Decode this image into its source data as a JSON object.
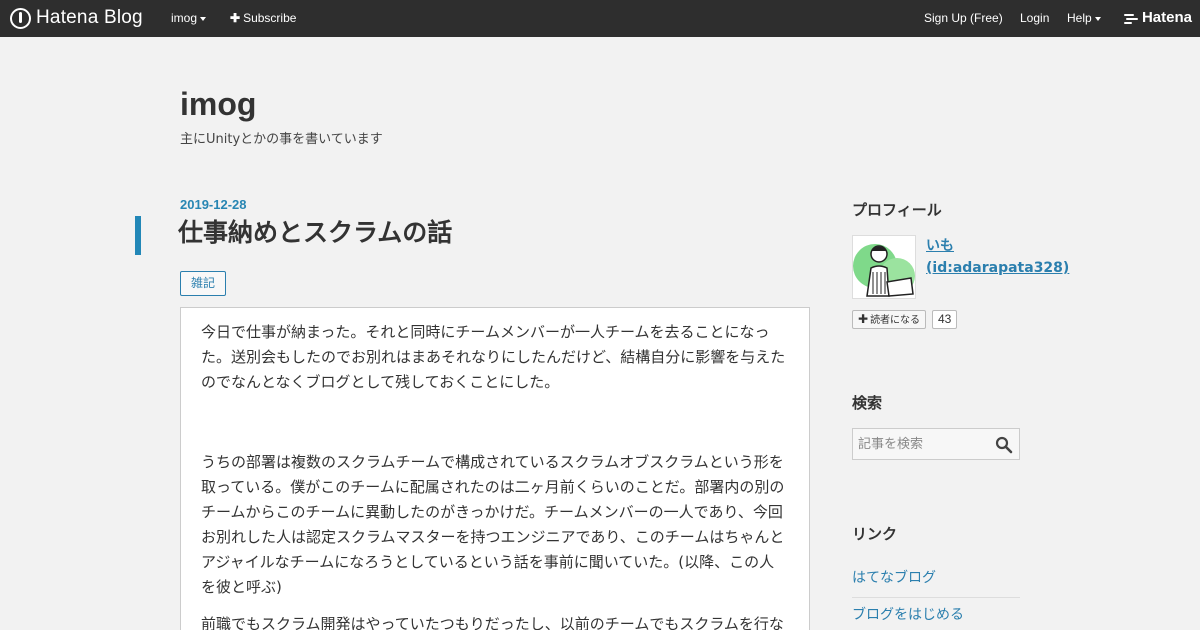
{
  "topbar": {
    "brand": "Hatena Blog",
    "blog_menu": "imog",
    "subscribe": "Subscribe",
    "signup": "Sign Up (Free)",
    "login": "Login",
    "help": "Help",
    "hatena": "Hatena"
  },
  "blog": {
    "title": "imog",
    "description": "主にUnityとかの事を書いています"
  },
  "entry": {
    "date": "2019-12-28",
    "title": "仕事納めとスクラムの話",
    "category": "雑記",
    "paragraphs": [
      "今日で仕事が納まった。それと同時にチームメンバーが一人チームを去ることになった。送別会もしたのでお別れはまあそれなりにしたんだけど、結構自分に影響を与えたのでなんとなくブログとして残しておくことにした。",
      "うちの部署は複数のスクラムチームで構成されているスクラムオブスクラムという形を取っている。僕がこのチームに配属されたのは二ヶ月前くらいのことだ。部署内の別のチームからこのチームに異動したのがきっかけだ。チームメンバーの一人であり、今回お別れした人は認定スクラムマスターを持つエンジニアであり、このチームはちゃんとアジャイルなチームになろうとしているという話を事前に聞いていた。(以降、この人を彼と呼ぶ)",
      "前職でもスクラム開発はやっていたつもりだったし、以前のチームでもスクラムを行な"
    ]
  },
  "sidebar": {
    "profile_heading": "プロフィール",
    "profile_name": "いも (id:adarapata328)",
    "reader_button": "読者になる",
    "reader_count": "43",
    "search_heading": "検索",
    "search_placeholder": "記事を検索",
    "links_heading": "リンク",
    "links": [
      "はてなブログ",
      "ブログをはじめる"
    ]
  }
}
